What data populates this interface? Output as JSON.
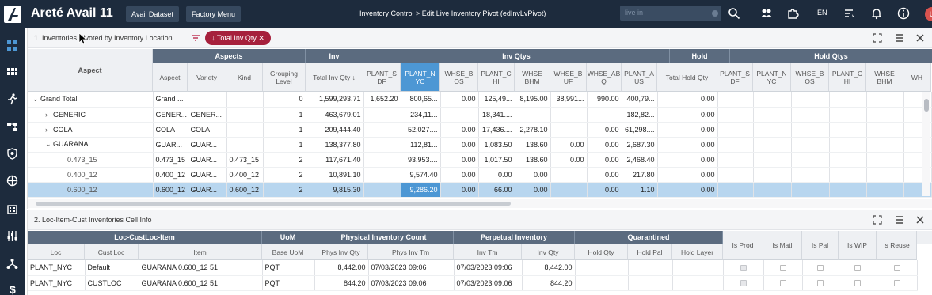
{
  "app": {
    "title": "Areté Avail 11"
  },
  "toolbar": {
    "avail_dataset": "Avail Dataset",
    "factory_menu": "Factory Menu"
  },
  "breadcrumb": {
    "prefix": "Inventory Control > Edit Live Inventory Pivot (",
    "link": "edInvLvPivot",
    "suffix": ")"
  },
  "search": {
    "placeholder": "live in"
  },
  "lang": "EN",
  "avatar": "U",
  "panel1": {
    "title": "1. Inventories Pivoted by Inventory Location",
    "chip": "↓ Total Inv Qty ✕",
    "groups": [
      {
        "label": "Aspects"
      },
      {
        "label": "Inv"
      },
      {
        "label": "Inv Qtys"
      },
      {
        "label": "Hold"
      },
      {
        "label": "Hold Qtys"
      }
    ],
    "aspect_header": "Aspect",
    "columns": [
      "Aspect",
      "Variety",
      "Kind",
      "Grouping Level",
      "Total Inv Qty ↓",
      "PLANT_S DF",
      "PLANT_N YC",
      "WHSE_B OS",
      "PLANT_C HI",
      "WHSE BHM",
      "WHSE_B UF",
      "WHSE_AB Q",
      "PLANT_A US",
      "Total Hold Qty",
      "PLANT_S DF",
      "PLANT_N YC",
      "WHSE_B OS",
      "PLANT_C HI",
      "WHSE BHM",
      "WH"
    ],
    "rows": [
      {
        "tree": "⌄",
        "label": "Grand Total",
        "cells": [
          "Grand ...",
          "",
          "",
          "0",
          "1,599,293.71",
          "1,652.20",
          "800,65...",
          "0.00",
          "125,49...",
          "8,195.00",
          "38,991...",
          "990.00",
          "400,79...",
          "0.00",
          "",
          "",
          "",
          "",
          "",
          ""
        ]
      },
      {
        "tree": "›",
        "label": "GENERIC",
        "cells": [
          "GENER...",
          "GENER...",
          "",
          "1",
          "463,679.01",
          "",
          "234,11...",
          "",
          "18,341....",
          "",
          "",
          "",
          "182,82...",
          "0.00",
          "",
          "",
          "",
          "",
          "",
          ""
        ]
      },
      {
        "tree": "›",
        "label": "COLA",
        "cells": [
          "COLA",
          "COLA",
          "",
          "1",
          "209,444.40",
          "",
          "52,027....",
          "0.00",
          "17,436....",
          "2,278.10",
          "",
          "0.00",
          "61,298....",
          "0.00",
          "",
          "",
          "",
          "",
          "",
          ""
        ]
      },
      {
        "tree": "⌄",
        "label": "GUARANA",
        "cells": [
          "GUAR...",
          "GUAR...",
          "",
          "1",
          "138,377.80",
          "",
          "112,81...",
          "0.00",
          "1,083.50",
          "138.60",
          "0.00",
          "0.00",
          "2,687.30",
          "0.00",
          "",
          "",
          "",
          "",
          "",
          ""
        ]
      },
      {
        "tree": "",
        "label": "0.473_15",
        "cells": [
          "0.473_15",
          "GUAR...",
          "0.473_15",
          "2",
          "117,671.40",
          "",
          "93,953....",
          "0.00",
          "1,017.50",
          "138.60",
          "0.00",
          "0.00",
          "2,468.40",
          "0.00",
          "",
          "",
          "",
          "",
          "",
          ""
        ]
      },
      {
        "tree": "",
        "label": "0.400_12",
        "cells": [
          "0.400_12",
          "GUAR...",
          "0.400_12",
          "2",
          "10,891.10",
          "",
          "9,574.40",
          "0.00",
          "0.00",
          "0.00",
          "",
          "0.00",
          "217.80",
          "0.00",
          "",
          "",
          "",
          "",
          "",
          ""
        ]
      },
      {
        "tree": "",
        "label": "0.600_12",
        "cells": [
          "0.600_12",
          "GUAR...",
          "0.600_12",
          "2",
          "9,815.30",
          "",
          "9,286.20",
          "0.00",
          "66.00",
          "0.00",
          "",
          "0.00",
          "1.10",
          "0.00",
          "",
          "",
          "",
          "",
          "",
          ""
        ]
      }
    ]
  },
  "panel2": {
    "title": "2. Loc-Item-Cust Inventories Cell Info",
    "groups": [
      {
        "label": "Loc-CustLoc-Item"
      },
      {
        "label": "UoM"
      },
      {
        "label": "Physical Inventory Count"
      },
      {
        "label": "Perpetual Inventory"
      },
      {
        "label": "Quarantined"
      }
    ],
    "columns": [
      "Loc",
      "Cust Loc",
      "Item",
      "Base UoM",
      "Phys Inv Qty",
      "Phys Inv Tm",
      "Inv Tm",
      "Inv Qty",
      "Hold Qty",
      "Hold Pal",
      "Hold Layer",
      "Is Prod",
      "Is Matl",
      "Is Pal",
      "Is WIP",
      "Is Reuse"
    ],
    "rows": [
      {
        "cells": [
          "PLANT_NYC",
          "Default",
          "GUARANA 0.600_12 51",
          "PQT",
          "8,442.00",
          "07/03/2023 09:06",
          "07/03/2023 09:06",
          "8,442.00",
          "",
          "",
          ""
        ],
        "checks": [
          true,
          false,
          false,
          false,
          false
        ]
      },
      {
        "cells": [
          "PLANT_NYC",
          "CUSTLOC",
          "GUARANA 0.600_12 51",
          "PQT",
          "844.20",
          "07/03/2023 09:06",
          "07/03/2023 09:06",
          "844.20",
          "",
          "",
          ""
        ],
        "checks": [
          true,
          false,
          false,
          false,
          false
        ]
      }
    ]
  },
  "colors": {
    "topbar": "#1d2b3d",
    "header": "#5b6b7f",
    "selected": "#4d97d4",
    "chip": "#a6203c"
  }
}
